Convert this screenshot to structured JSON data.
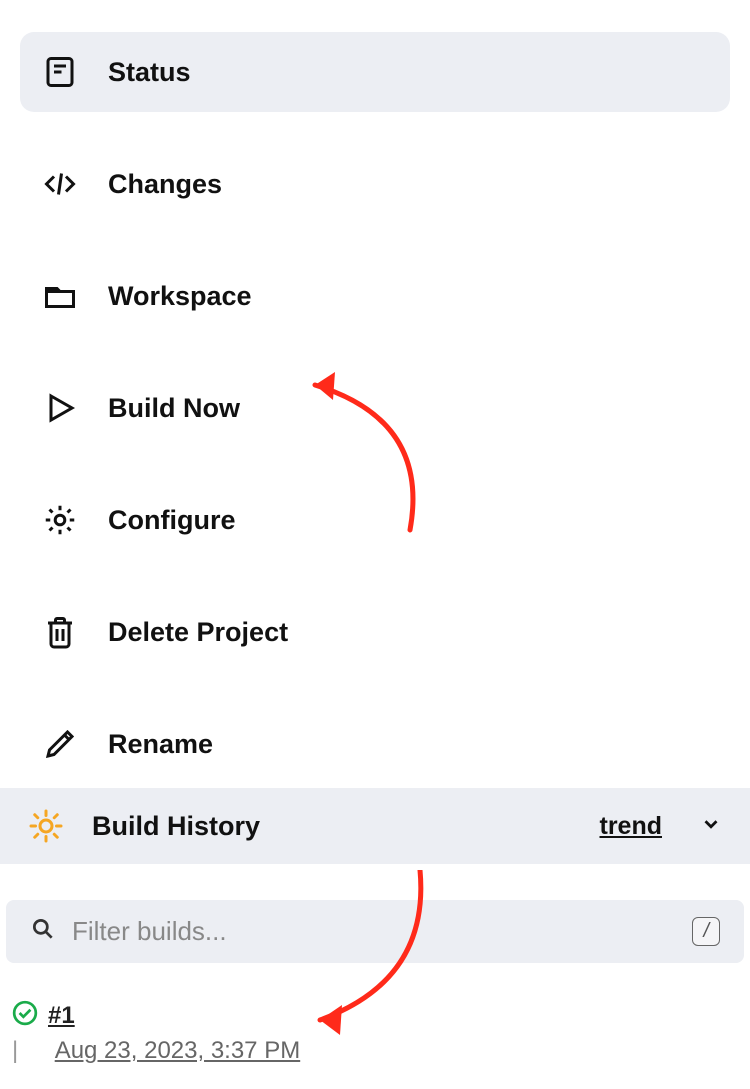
{
  "sidebar": {
    "items": [
      {
        "label": "Status"
      },
      {
        "label": "Changes"
      },
      {
        "label": "Workspace"
      },
      {
        "label": "Build Now"
      },
      {
        "label": "Configure"
      },
      {
        "label": "Delete Project"
      },
      {
        "label": "Rename"
      }
    ]
  },
  "buildHistory": {
    "title": "Build History",
    "trendLabel": "trend",
    "filterPlaceholder": "Filter builds...",
    "kbdHint": "/",
    "builds": [
      {
        "number": "#1",
        "date": "Aug 23, 2023, 3:37 PM",
        "status": "success"
      }
    ]
  }
}
